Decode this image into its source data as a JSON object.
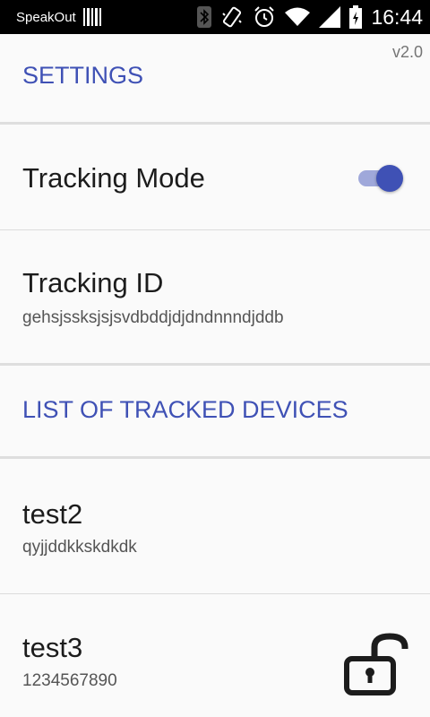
{
  "status_bar": {
    "carrier": "SpeakOut",
    "time": "16:44",
    "icons": [
      "barcode-icon",
      "bluetooth-icon",
      "vibrate-icon",
      "alarm-icon",
      "wifi-icon",
      "signal-icon",
      "battery-charging-icon"
    ]
  },
  "version": "v2.0",
  "settings": {
    "header": "SETTINGS",
    "tracking_mode": {
      "label": "Tracking Mode",
      "enabled": true
    },
    "tracking_id": {
      "label": "Tracking ID",
      "value": "gehsjssksjsjsvdbddjdjdndnnndjddb"
    }
  },
  "devices": {
    "header": "LIST OF TRACKED DEVICES",
    "items": [
      {
        "name": "test2",
        "id": "qyjjddkkskdkdk",
        "icon": null
      },
      {
        "name": "test3",
        "id": "1234567890",
        "icon": "unlocked-padlock-icon"
      }
    ]
  },
  "colors": {
    "accent": "#3f51b5",
    "toggle_track": "#9fa8da",
    "background": "#fafafa",
    "status_bar": "#000000"
  }
}
